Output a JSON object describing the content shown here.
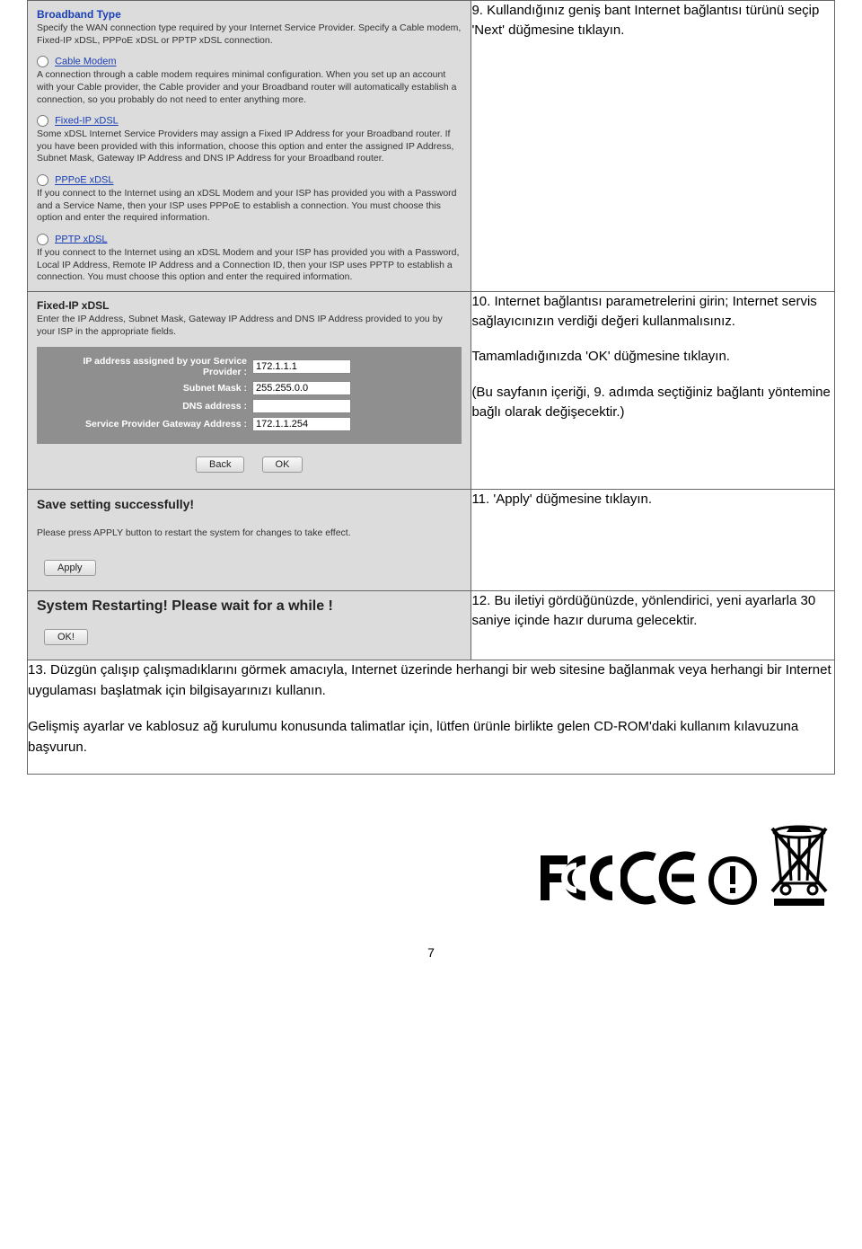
{
  "broadband": {
    "heading": "Broadband Type",
    "sub": "Specify the WAN connection type required by your Internet Service Provider. Specify a Cable modem, Fixed-IP xDSL, PPPoE xDSL or PPTP xDSL connection.",
    "opts": {
      "cable": {
        "label": "Cable Modem",
        "desc": "A connection through a cable modem requires minimal configuration. When you set up an account with your Cable provider, the Cable provider and your Broadband router will automatically establish a connection, so you probably do not need to enter anything more."
      },
      "fixed": {
        "label": "Fixed-IP xDSL",
        "desc": "Some xDSL Internet Service Providers may assign a Fixed IP Address for your Broadband router. If you have been provided with this information, choose this option and enter the assigned IP Address, Subnet Mask, Gateway IP Address and DNS IP Address for your Broadband router."
      },
      "pppoe": {
        "label": "PPPoE xDSL",
        "desc": "If you connect to the Internet using an xDSL Modem and your ISP has provided you with a Password and a Service Name, then your ISP uses PPPoE to establish a connection. You must choose this option and enter the required information."
      },
      "pptp": {
        "label": "PPTP xDSL",
        "desc": "If you connect to the Internet using an xDSL Modem and your ISP has provided you with a Password, Local IP Address, Remote IP Address and a Connection ID, then your ISP uses PPTP to establish a connection. You must choose this option and enter the required information."
      }
    }
  },
  "fixed_panel": {
    "title": "Fixed-IP xDSL",
    "desc": "Enter the IP Address, Subnet Mask, Gateway IP Address and DNS IP Address provided to you by your ISP in the appropriate fields.",
    "fields": {
      "ip_label": "IP address assigned by your Service Provider :",
      "ip_val": "172.1.1.1",
      "mask_label": "Subnet Mask :",
      "mask_val": "255.255.0.0",
      "dns_label": "DNS address :",
      "dns_val": "",
      "gw_label": "Service Provider Gateway Address :",
      "gw_val": "172.1.1.254"
    },
    "buttons": {
      "back": "Back",
      "ok": "OK"
    }
  },
  "save_panel": {
    "title": "Save setting successfully!",
    "msg": "Please press APPLY button to restart the system for changes to take effect.",
    "apply": "Apply"
  },
  "restart_panel": {
    "title": "System Restarting! Please wait for a while !",
    "ok": "OK!"
  },
  "instructions": {
    "step9": "9. Kullandığınız geniş bant Internet bağlantısı türünü seçip 'Next' düğmesine tıklayın.",
    "step10a": "10. Internet bağlantısı parametrelerini girin; Internet servis sağlayıcınızın verdiği değeri kullanmalısınız.",
    "step10b": "Tamamladığınızda 'OK' düğmesine tıklayın.",
    "step10c": "(Bu sayfanın içeriği, 9. adımda seçtiğiniz bağlantı yöntemine bağlı olarak değişecektir.)",
    "step11": "11. 'Apply' düğmesine tıklayın.",
    "step12": "12. Bu iletiyi gördüğünüzde, yönlendirici, yeni ayarlarla 30 saniye içinde hazır duruma gelecektir.",
    "step13": "13. Düzgün çalışıp çalışmadıklarını görmek amacıyla, Internet üzerinde herhangi bir web sitesine bağlanmak veya herhangi bir Internet uygulaması başlatmak için bilgisayarınızı kullanın.",
    "step13b": "Gelişmiş ayarlar ve kablosuz ağ kurulumu konusunda talimatlar için, lütfen ürünle birlikte gelen CD-ROM'daki kullanım kılavuzuna başvurun."
  },
  "page_number": "7"
}
